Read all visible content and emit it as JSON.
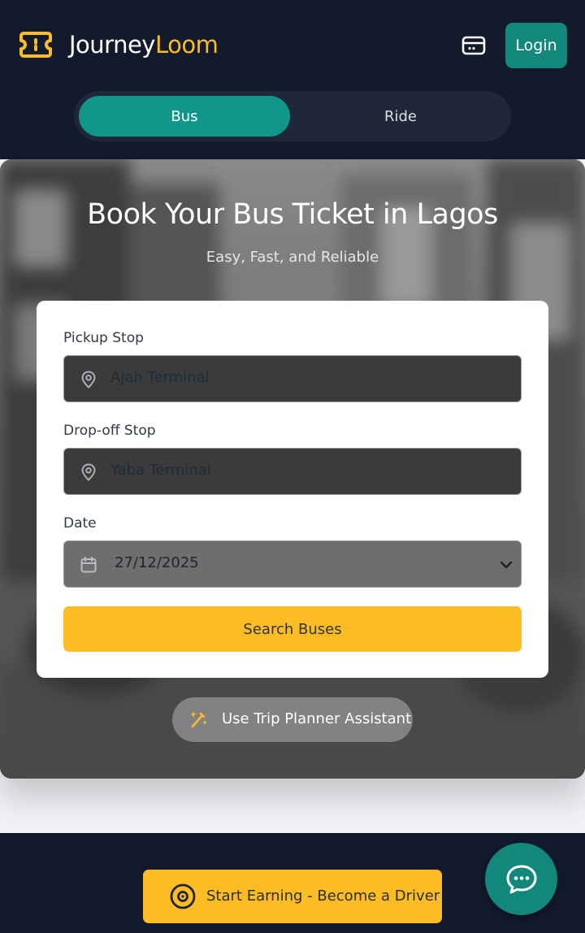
{
  "app": {
    "brand_primary": "Journey",
    "brand_accent": "Loom",
    "login_label": "Login",
    "logo_icon": "ticket-icon",
    "card_icon": "credit-card-icon"
  },
  "tabs": [
    {
      "label": "Bus",
      "active": true
    },
    {
      "label": "Ride",
      "active": false
    }
  ],
  "hero": {
    "title": "Book Your Bus Ticket in Lagos",
    "subtitle": "Easy, Fast, and Reliable"
  },
  "form": {
    "pickup_label": "Pickup Stop",
    "pickup_value": "Ajah Terminal",
    "dropoff_label": "Drop-off Stop",
    "dropoff_value": "Yaba Terminal",
    "date_label": "Date",
    "date_value": "27/12/2025",
    "search_label": "Search Buses"
  },
  "assistant": {
    "label": "Use Trip Planner Assistant",
    "icon": "magic-wand-icon"
  },
  "footer": {
    "driver_label": "Start Earning - Become a Driver",
    "driver_icon": "steering-wheel-icon",
    "chat_icon": "chat-bubble-icon"
  },
  "colors": {
    "navy": "#121a2c",
    "teal": "#12877c",
    "tab_active": "#11968a",
    "yellow": "#fbbd23"
  }
}
